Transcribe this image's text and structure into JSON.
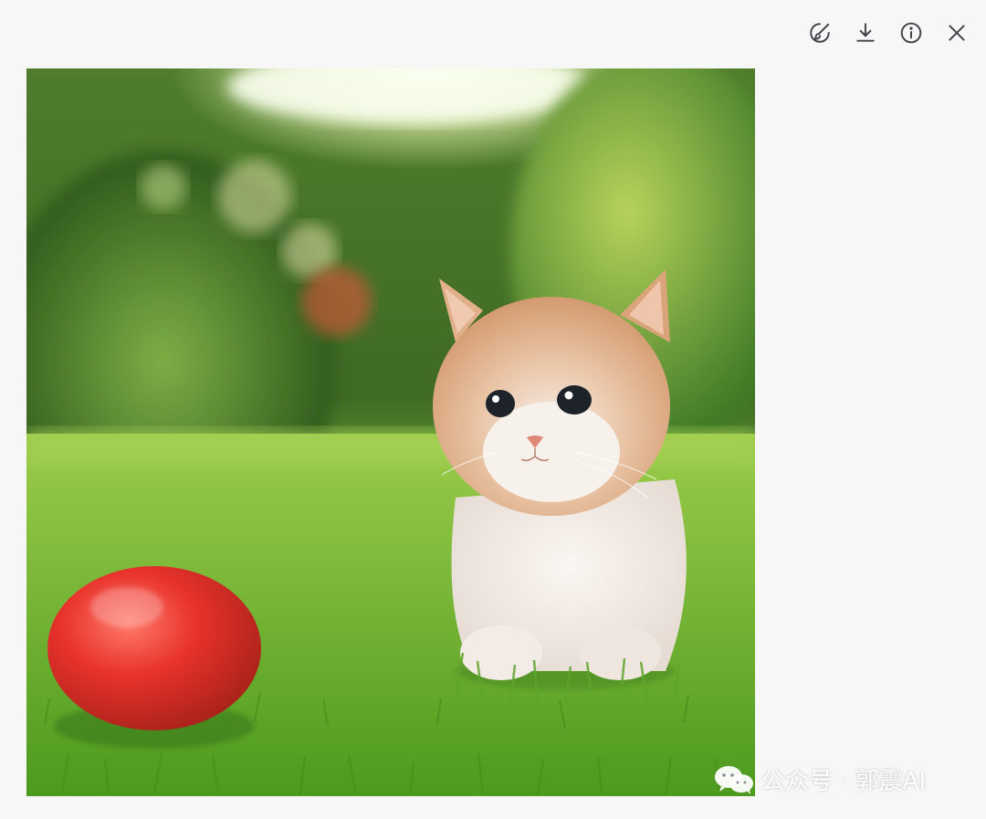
{
  "toolbar": {
    "buttons": [
      {
        "name": "edit-image-button",
        "icon": "brush-edit-icon"
      },
      {
        "name": "download-button",
        "icon": "download-icon"
      },
      {
        "name": "info-button",
        "icon": "info-icon"
      },
      {
        "name": "close-button",
        "icon": "close-icon"
      }
    ],
    "icon_color": "#404048"
  },
  "image": {
    "subject": "kitten-apple-garden-image"
  },
  "watermark": {
    "text": "公众号 · 郭震AI",
    "icon": "wechat-icon"
  },
  "colors": {
    "background": "#f7f7f8",
    "grass": "#6fb63a",
    "apple": "#e0302a"
  }
}
